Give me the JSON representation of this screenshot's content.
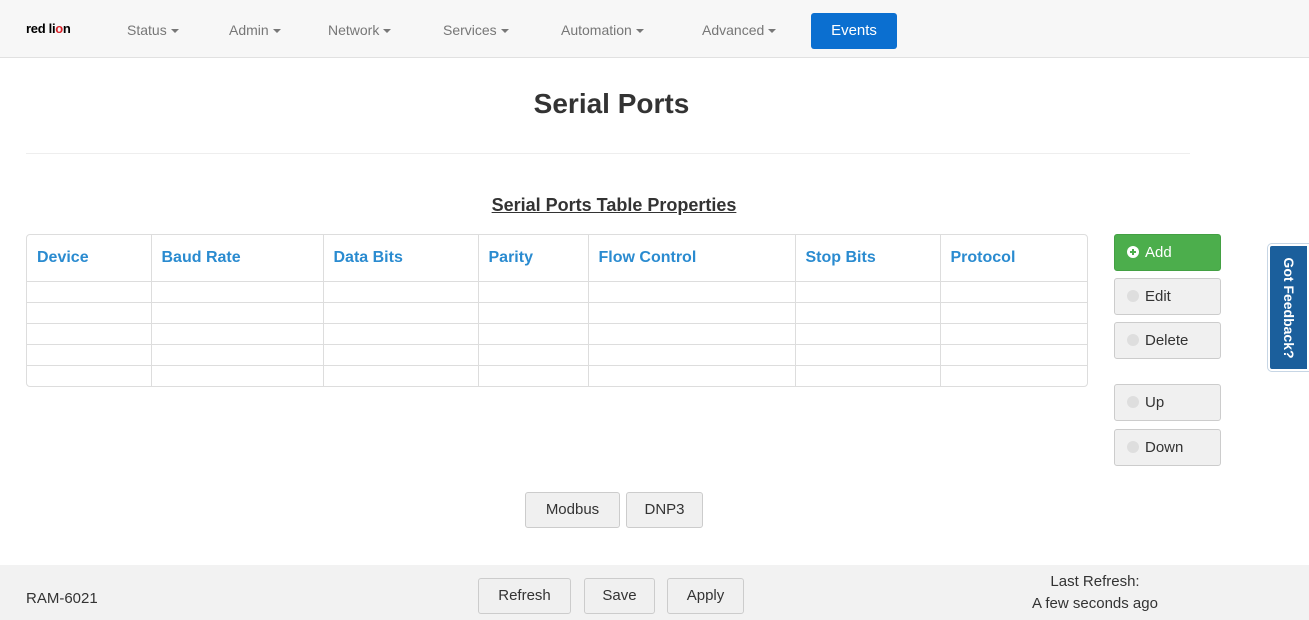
{
  "navbar": {
    "logo_left": "red li",
    "logo_accent": "o",
    "logo_right": "n",
    "items": [
      {
        "label": "Status"
      },
      {
        "label": "Admin"
      },
      {
        "label": "Network"
      },
      {
        "label": "Services"
      },
      {
        "label": "Automation"
      },
      {
        "label": "Advanced"
      }
    ],
    "active": {
      "label": "Events",
      "color": "#0b6fd0"
    }
  },
  "page": {
    "title": "Serial Ports",
    "table_heading": "Serial Ports Table Properties"
  },
  "table": {
    "columns": [
      "Device",
      "Baud Rate",
      "Data Bits",
      "Parity",
      "Flow Control",
      "Stop Bits",
      "Protocol"
    ],
    "rows": [
      [
        "",
        "",
        "",
        "",
        "",
        "",
        ""
      ],
      [
        "",
        "",
        "",
        "",
        "",
        "",
        ""
      ],
      [
        "",
        "",
        "",
        "",
        "",
        "",
        ""
      ],
      [
        "",
        "",
        "",
        "",
        "",
        "",
        ""
      ],
      [
        "",
        "",
        "",
        "",
        "",
        "",
        ""
      ]
    ]
  },
  "actions": {
    "add": "Add",
    "edit": "Edit",
    "delete": "Delete",
    "up": "Up",
    "down": "Down"
  },
  "protocol_buttons": {
    "modbus": "Modbus",
    "dnp3": "DNP3"
  },
  "feedback_tab": "Got Feedback?",
  "footer": {
    "device": "RAM-6021",
    "refresh": "Refresh",
    "save": "Save",
    "apply": "Apply",
    "last_refresh_label": "Last Refresh:",
    "last_refresh_value": "A few seconds ago"
  },
  "colors": {
    "accent_blue": "#0b6fd0",
    "header_blue": "#2a8bd0",
    "add_green": "#4cae4c",
    "feedback_blue": "#1b5f9c"
  }
}
